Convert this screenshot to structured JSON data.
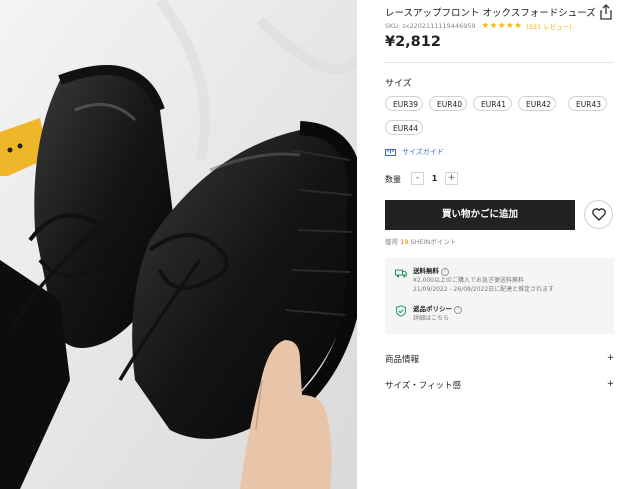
{
  "product": {
    "title": "レースアップフロント オックスフォードシューズ",
    "sku": "SKU: sx2202111119446959",
    "stars": "★★★★★",
    "reviews": "(331 レビュー)",
    "price": "¥2,812"
  },
  "size_section": {
    "label": "サイズ",
    "options": [
      "EUR39",
      "EUR40",
      "EUR41",
      "EUR42",
      "EUR43",
      "EUR44"
    ],
    "guide": "サイズガイド"
  },
  "quantity": {
    "label": "数量",
    "minus": "-",
    "value": "1",
    "plus": "+"
  },
  "cart": {
    "add_label": "買い物かごに追加"
  },
  "points": {
    "prefix": "獲得",
    "value": "19",
    "suffix": "SHEINポイント"
  },
  "shipping": {
    "free_title": "送料無料",
    "free_line1": "¥2,000以上のご購入でお急ぎ便送料無料",
    "free_line2": "21/09/2022 - 26/09/2022日に配達と推定されます",
    "policy_title": "返品ポリシー",
    "policy_line": "詳細はこちら"
  },
  "accordion": [
    {
      "label": "商品情報",
      "toggle": "+"
    },
    {
      "label": "サイズ・フィット感",
      "toggle": "+"
    }
  ],
  "colors": {
    "accent_star": "#f7b500",
    "link": "#2f6ec8",
    "cart_button": "#222222"
  },
  "icons": [
    "share-icon",
    "ruler-icon",
    "heart-icon",
    "truck-icon",
    "shield-icon",
    "question-icon"
  ]
}
